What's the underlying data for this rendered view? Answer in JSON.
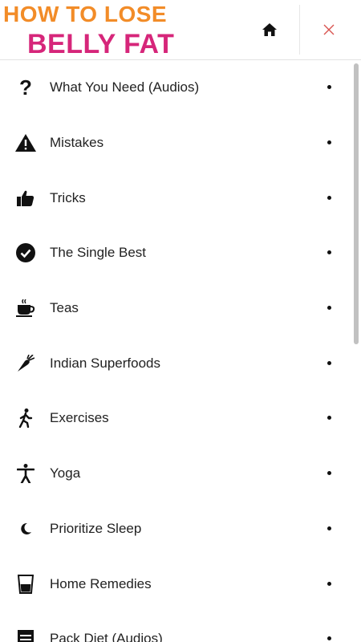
{
  "header": {
    "logo_line1": "HOW TO LOSE",
    "logo_line2": "BELLY FAT",
    "home_icon": "home-icon",
    "close_icon": "close-icon",
    "colors": {
      "logo_orange": "#f28c28",
      "logo_pink": "#d6267a",
      "close_red": "#d9534f"
    }
  },
  "menu": {
    "items": [
      {
        "label": "What You Need (Audios)",
        "icon": "question-mark-icon"
      },
      {
        "label": "Mistakes",
        "icon": "warning-icon"
      },
      {
        "label": "Tricks",
        "icon": "thumbs-up-icon"
      },
      {
        "label": "The Single Best",
        "icon": "check-circle-icon"
      },
      {
        "label": "Teas",
        "icon": "tea-cup-icon"
      },
      {
        "label": "Indian Superfoods",
        "icon": "carrot-icon"
      },
      {
        "label": "Exercises",
        "icon": "walking-icon"
      },
      {
        "label": "Yoga",
        "icon": "yoga-pose-icon"
      },
      {
        "label": "Prioritize Sleep",
        "icon": "moon-icon"
      },
      {
        "label": "Home Remedies",
        "icon": "glass-icon"
      },
      {
        "label": "Pack Diet (Audios)",
        "icon": "notepad-icon"
      }
    ]
  }
}
